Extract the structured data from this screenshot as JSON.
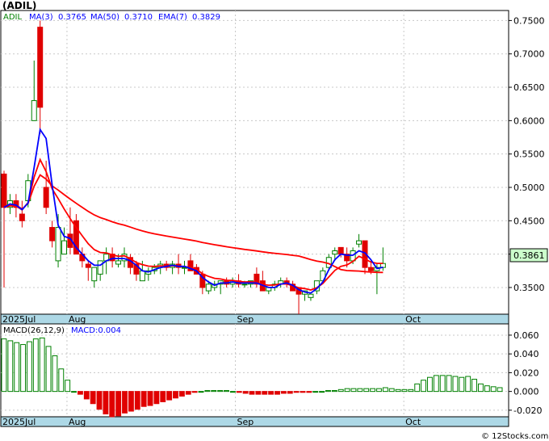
{
  "symbol_label": "(ADIL)",
  "ticker": "ADIL",
  "legend": {
    "ma3": "MA(3)",
    "ma3_value": "0.3765",
    "ma50": "MA(50)",
    "ma50_value": "0.3710",
    "ema7": "EMA(7)",
    "ema7_value": "0.3829"
  },
  "macd_legend": {
    "label": "MACD(26,12,9)",
    "value_label": "MACD:0.004"
  },
  "last_price_label": "0.3861",
  "watermark": "© 12Stocks.com",
  "colors": {
    "up": "#008000",
    "down": "#e00000",
    "ma3": "#0000ff",
    "ema7": "#ff0000",
    "ma50": "#ff0000",
    "axis_band": "#add8e6",
    "last_price_box": "#ccffcc"
  },
  "chart_data": [
    {
      "type": "candlestick",
      "price_axis": {
        "ticks": [
          "0.7500",
          "0.7000",
          "0.6500",
          "0.6000",
          "0.5500",
          "0.5000",
          "0.4500",
          "0.4000",
          "0.3500"
        ],
        "ylim": [
          0.31,
          0.765
        ]
      },
      "x_labels": [
        "2025Jul",
        "Aug",
        "Sep",
        "Oct"
      ],
      "x_label_index": [
        0,
        11,
        39,
        67
      ],
      "candles": [
        [
          0.52,
          0.525,
          0.35,
          0.47
        ],
        [
          0.47,
          0.49,
          0.46,
          0.48
        ],
        [
          0.48,
          0.49,
          0.455,
          0.47
        ],
        [
          0.46,
          0.48,
          0.44,
          0.45
        ],
        [
          0.48,
          0.52,
          0.47,
          0.51
        ],
        [
          0.6,
          0.69,
          0.6,
          0.63
        ],
        [
          0.74,
          0.75,
          0.58,
          0.62
        ],
        [
          0.5,
          0.54,
          0.46,
          0.47
        ],
        [
          0.44,
          0.45,
          0.41,
          0.42
        ],
        [
          0.39,
          0.46,
          0.38,
          0.44
        ],
        [
          0.4,
          0.44,
          0.4,
          0.42
        ],
        [
          0.43,
          0.47,
          0.4,
          0.41
        ],
        [
          0.45,
          0.46,
          0.4,
          0.4
        ],
        [
          0.4,
          0.41,
          0.38,
          0.39
        ],
        [
          0.385,
          0.39,
          0.36,
          0.38
        ],
        [
          0.36,
          0.37,
          0.35,
          0.38
        ],
        [
          0.37,
          0.37,
          0.36,
          0.39
        ],
        [
          0.39,
          0.41,
          0.37,
          0.4
        ],
        [
          0.4,
          0.41,
          0.38,
          0.39
        ],
        [
          0.385,
          0.4,
          0.38,
          0.39
        ],
        [
          0.39,
          0.41,
          0.38,
          0.4
        ],
        [
          0.395,
          0.4,
          0.37,
          0.38
        ],
        [
          0.385,
          0.39,
          0.36,
          0.37
        ],
        [
          0.36,
          0.39,
          0.36,
          0.375
        ],
        [
          0.37,
          0.38,
          0.36,
          0.375
        ],
        [
          0.375,
          0.385,
          0.37,
          0.38
        ],
        [
          0.38,
          0.39,
          0.37,
          0.385
        ],
        [
          0.385,
          0.39,
          0.375,
          0.38
        ],
        [
          0.38,
          0.39,
          0.37,
          0.385
        ],
        [
          0.385,
          0.4,
          0.37,
          0.38
        ],
        [
          0.38,
          0.39,
          0.37,
          0.38
        ],
        [
          0.39,
          0.4,
          0.38,
          0.375
        ],
        [
          0.38,
          0.385,
          0.37,
          0.37
        ],
        [
          0.37,
          0.375,
          0.34,
          0.35
        ],
        [
          0.345,
          0.36,
          0.34,
          0.355
        ],
        [
          0.35,
          0.36,
          0.345,
          0.355
        ],
        [
          0.355,
          0.36,
          0.34,
          0.36
        ],
        [
          0.36,
          0.365,
          0.35,
          0.355
        ],
        [
          0.355,
          0.365,
          0.35,
          0.36
        ],
        [
          0.36,
          0.37,
          0.35,
          0.355
        ],
        [
          0.355,
          0.36,
          0.35,
          0.355
        ],
        [
          0.355,
          0.36,
          0.35,
          0.36
        ],
        [
          0.37,
          0.38,
          0.35,
          0.355
        ],
        [
          0.36,
          0.375,
          0.355,
          0.345
        ],
        [
          0.345,
          0.35,
          0.34,
          0.35
        ],
        [
          0.35,
          0.36,
          0.345,
          0.355
        ],
        [
          0.355,
          0.365,
          0.35,
          0.36
        ],
        [
          0.36,
          0.365,
          0.35,
          0.355
        ],
        [
          0.355,
          0.36,
          0.345,
          0.345
        ],
        [
          0.35,
          0.35,
          0.31,
          0.34
        ],
        [
          0.34,
          0.34,
          0.33,
          0.345
        ],
        [
          0.335,
          0.34,
          0.33,
          0.34
        ],
        [
          0.345,
          0.36,
          0.34,
          0.36
        ],
        [
          0.36,
          0.38,
          0.36,
          0.375
        ],
        [
          0.38,
          0.4,
          0.375,
          0.395
        ],
        [
          0.4,
          0.41,
          0.39,
          0.405
        ],
        [
          0.41,
          0.41,
          0.395,
          0.4
        ],
        [
          0.4,
          0.41,
          0.38,
          0.39
        ],
        [
          0.39,
          0.41,
          0.385,
          0.405
        ],
        [
          0.415,
          0.43,
          0.41,
          0.42
        ],
        [
          0.42,
          0.42,
          0.37,
          0.38
        ],
        [
          0.38,
          0.39,
          0.37,
          0.375
        ],
        [
          0.375,
          0.385,
          0.34,
          0.38
        ],
        [
          0.38,
          0.41,
          0.375,
          0.386
        ]
      ]
    },
    {
      "type": "bar",
      "name": "MACD",
      "macd_axis": {
        "ticks": [
          "0.060",
          "0.040",
          "0.020",
          "0.000",
          "-0.020"
        ],
        "ylim": [
          -0.027,
          0.072
        ]
      },
      "values": [
        0.056,
        0.054,
        0.052,
        0.05,
        0.053,
        0.056,
        0.057,
        0.048,
        0.038,
        0.024,
        0.012,
        0.0,
        -0.003,
        -0.008,
        -0.013,
        -0.019,
        -0.024,
        -0.027,
        -0.026,
        -0.023,
        -0.021,
        -0.019,
        -0.016,
        -0.015,
        -0.013,
        -0.011,
        -0.009,
        -0.007,
        -0.005,
        -0.003,
        -0.001,
        0.0,
        0.001,
        0.001,
        0.001,
        0.001,
        0.0,
        -0.001,
        -0.002,
        -0.003,
        -0.003,
        -0.003,
        -0.003,
        -0.003,
        -0.002,
        -0.002,
        -0.001,
        -0.001,
        -0.001,
        0.0,
        0.0,
        0.001,
        0.001,
        0.002,
        0.003,
        0.003,
        0.003,
        0.003,
        0.003,
        0.003,
        0.004,
        0.003,
        0.002,
        0.002,
        0.002,
        0.008,
        0.012,
        0.015,
        0.017,
        0.017,
        0.017,
        0.016,
        0.015,
        0.016,
        0.013,
        0.008,
        0.006,
        0.005,
        0.004
      ]
    }
  ]
}
